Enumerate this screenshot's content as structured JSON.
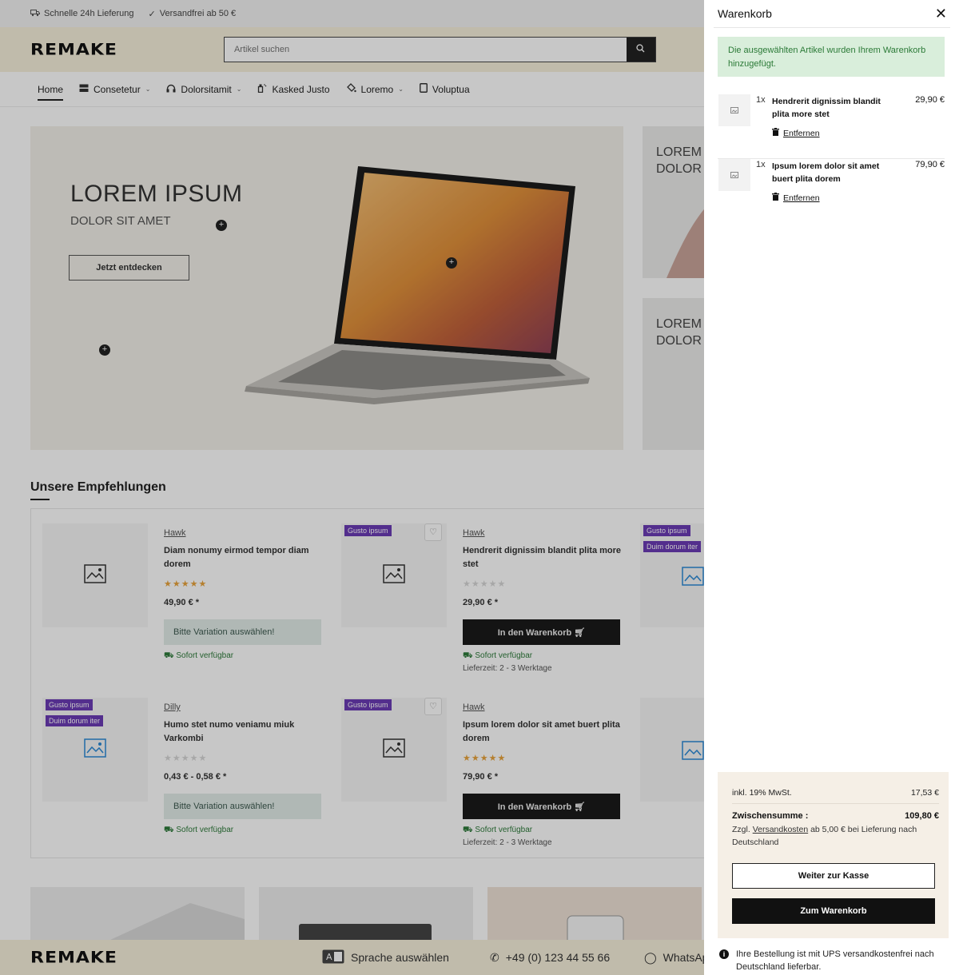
{
  "topbar": {
    "delivery": "Schnelle 24h Lieferung",
    "shipping": "Versandfrei ab 50 €"
  },
  "header": {
    "logo": "REMAKE",
    "search_placeholder": "Artikel suchen"
  },
  "nav": {
    "items": [
      {
        "label": "Home",
        "icon": "none"
      },
      {
        "label": "Consetetur",
        "icon": "server-icon"
      },
      {
        "label": "Dolorsitamit",
        "icon": "headphones-icon"
      },
      {
        "label": "Kasked Justo",
        "icon": "spray-icon"
      },
      {
        "label": "Loremo",
        "icon": "paint-bucket-icon"
      },
      {
        "label": "Voluptua",
        "icon": "tablet-icon"
      }
    ]
  },
  "hero": {
    "title": "LOREM IPSUM",
    "subtitle": "DOLOR SIT AMET",
    "button": "Jetzt entdecken",
    "side1": "LOREM DOLOR",
    "side2": "LOREM DOLOR"
  },
  "recommendations": {
    "title": "Unsere Empfehlungen",
    "products": [
      {
        "brand": "Hawk",
        "title": "Diam nonumy eirmod tempor diam dorem",
        "rating": 5,
        "price": "49,90 € *",
        "button": "Bitte Variation auswählen!",
        "availability": "Sofort verfügbar",
        "badges": []
      },
      {
        "brand": "Hawk",
        "title": "Hendrerit dignissim blandit plita more stet",
        "rating": 0,
        "price": "29,90 € *",
        "button": "In den Warenkorb",
        "availability": "Sofort verfügbar",
        "lead_time": "Lieferzeit: 2 - 3 Werktage",
        "badges": [
          "Gusto ipsum"
        ]
      },
      {
        "brand": "Dilly",
        "title": "Humo stet numo veniamu miuk Varkombi",
        "rating": 0,
        "price": "0,43 € - 0,58 € *",
        "button": "Bitte Variation auswählen!",
        "availability": "Sofort verfügbar",
        "badges": [
          "Gusto ipsum",
          "Duim dorum iter"
        ]
      },
      {
        "brand": "Hawk",
        "title": "Ipsum lorem dolor sit amet buert plita dorem",
        "rating": 5,
        "price": "79,90 € *",
        "button": "In den Warenkorb",
        "availability": "Sofort verfügbar",
        "lead_time": "Lieferzeit: 2 - 3 Werktage",
        "badges": [
          "Gusto ipsum"
        ]
      }
    ],
    "partial_badges": [
      "Gusto ipsum",
      "Duim dorum iter"
    ]
  },
  "footer": {
    "logo": "REMAKE",
    "language": "Sprache auswählen",
    "phone": "+49 (0) 123 44 55 66",
    "whatsapp": "WhatsAp"
  },
  "cart": {
    "title": "Warenkorb",
    "success_message": "Die ausgewählten Artikel wurden Ihrem Warenkorb hinzugefügt.",
    "items": [
      {
        "qty": "1x",
        "name": "Hendrerit dignissim blandit plita more stet",
        "price": "29,90 €",
        "remove": "Entfernen"
      },
      {
        "qty": "1x",
        "name": "Ipsum lorem dolor sit amet buert plita dorem",
        "price": "79,90 €",
        "remove": "Entfernen"
      }
    ],
    "vat_label": "inkl. 19% MwSt.",
    "vat_value": "17,53 €",
    "subtotal_label": "Zwischensumme :",
    "subtotal_value": "109,80 €",
    "shipping_prefix": "Zzgl.",
    "shipping_link": "Versandkosten",
    "shipping_suffix": "ab 5,00 € bei Lieferung nach Deutschland",
    "checkout_button": "Weiter zur Kasse",
    "cart_button": "Zum Warenkorb",
    "ups_note": "Ihre Bestellung ist mit UPS versandkostenfrei nach Deutschland lieferbar."
  },
  "colors": {
    "accent_dark": "#111111",
    "success_bg": "#d9eedb",
    "success_text": "#2b7a37",
    "badge_purple": "#6b3bb5",
    "header_bg": "#f6f0dc",
    "summary_bg": "#f5efe6",
    "star": "#e8a33c"
  }
}
